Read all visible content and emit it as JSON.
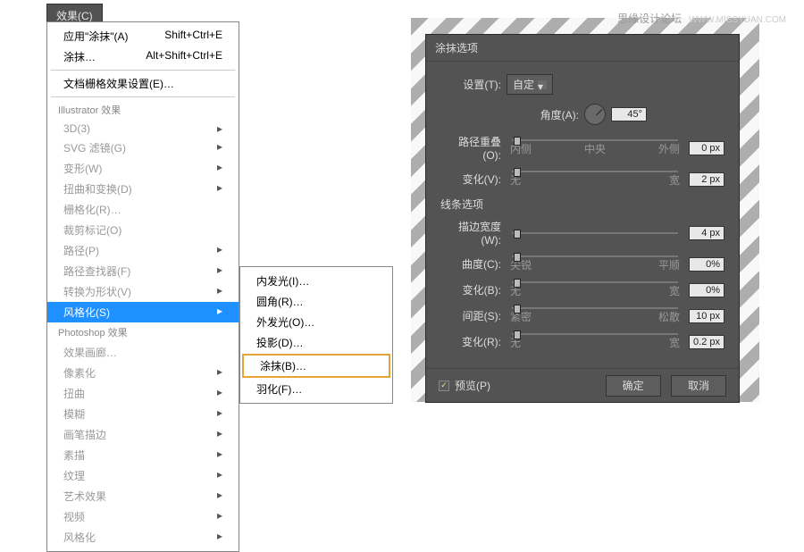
{
  "watermark": {
    "text": "思缘设计论坛",
    "url": "WWW.MISSYUAN.COM"
  },
  "menubar": {
    "label": "效果(C)"
  },
  "menu": {
    "apply": "应用\"涂抹\"(A)",
    "apply_sc": "Shift+Ctrl+E",
    "smudge": "涂抹…",
    "smudge_sc": "Alt+Shift+Ctrl+E",
    "docgrid": "文档栅格效果设置(E)…",
    "sec1": "Illustrator 效果",
    "i3d": "3D(3)",
    "svg": "SVG 滤镜(G)",
    "warp": "变形(W)",
    "distort": "扭曲和变换(D)",
    "raster": "栅格化(R)…",
    "crop": "裁剪标记(O)",
    "path": "路径(P)",
    "pathfinder": "路径查找器(F)",
    "convert": "转换为形状(V)",
    "stylize": "风格化(S)",
    "sec2": "Photoshop 效果",
    "gallery": "效果画廊…",
    "pixelate": "像素化",
    "twist": "扭曲",
    "blur": "模糊",
    "brush": "画笔描边",
    "sketch": "素描",
    "texture": "纹理",
    "artistic": "艺术效果",
    "video": "视频",
    "stylize2": "风格化"
  },
  "submenu": {
    "innerglow": "内发光(I)…",
    "round": "圆角(R)…",
    "outerglow": "外发光(O)…",
    "shadow": "投影(D)…",
    "scribble": "涂抹(B)…",
    "feather": "羽化(F)…"
  },
  "dialog": {
    "title": "涂抹选项",
    "settings_lbl": "设置(T):",
    "settings_val": "自定",
    "angle_lbl": "角度(A):",
    "angle_val": "45°",
    "overlap_lbl": "路径重叠(O):",
    "overlap_val": "0 px",
    "overlap_l": "内侧",
    "overlap_c": "中央",
    "overlap_r": "外侧",
    "var1_lbl": "变化(V):",
    "var1_val": "2 px",
    "var1_l": "无",
    "var1_r": "宽",
    "line_section": "线条选项",
    "stroke_lbl": "描边宽度(W):",
    "stroke_val": "4 px",
    "curve_lbl": "曲度(C):",
    "curve_val": "0%",
    "curve_l": "尖锐",
    "curve_r": "平顺",
    "var2_lbl": "变化(B):",
    "var2_val": "0%",
    "var2_l": "无",
    "var2_r": "宽",
    "spacing_lbl": "间距(S):",
    "spacing_val": "10 px",
    "spacing_l": "紧密",
    "spacing_r": "松散",
    "var3_lbl": "变化(R):",
    "var3_val": "0.2 px",
    "var3_l": "无",
    "var3_r": "宽",
    "preview": "预览(P)",
    "ok": "确定",
    "cancel": "取消"
  },
  "chart_data": null
}
